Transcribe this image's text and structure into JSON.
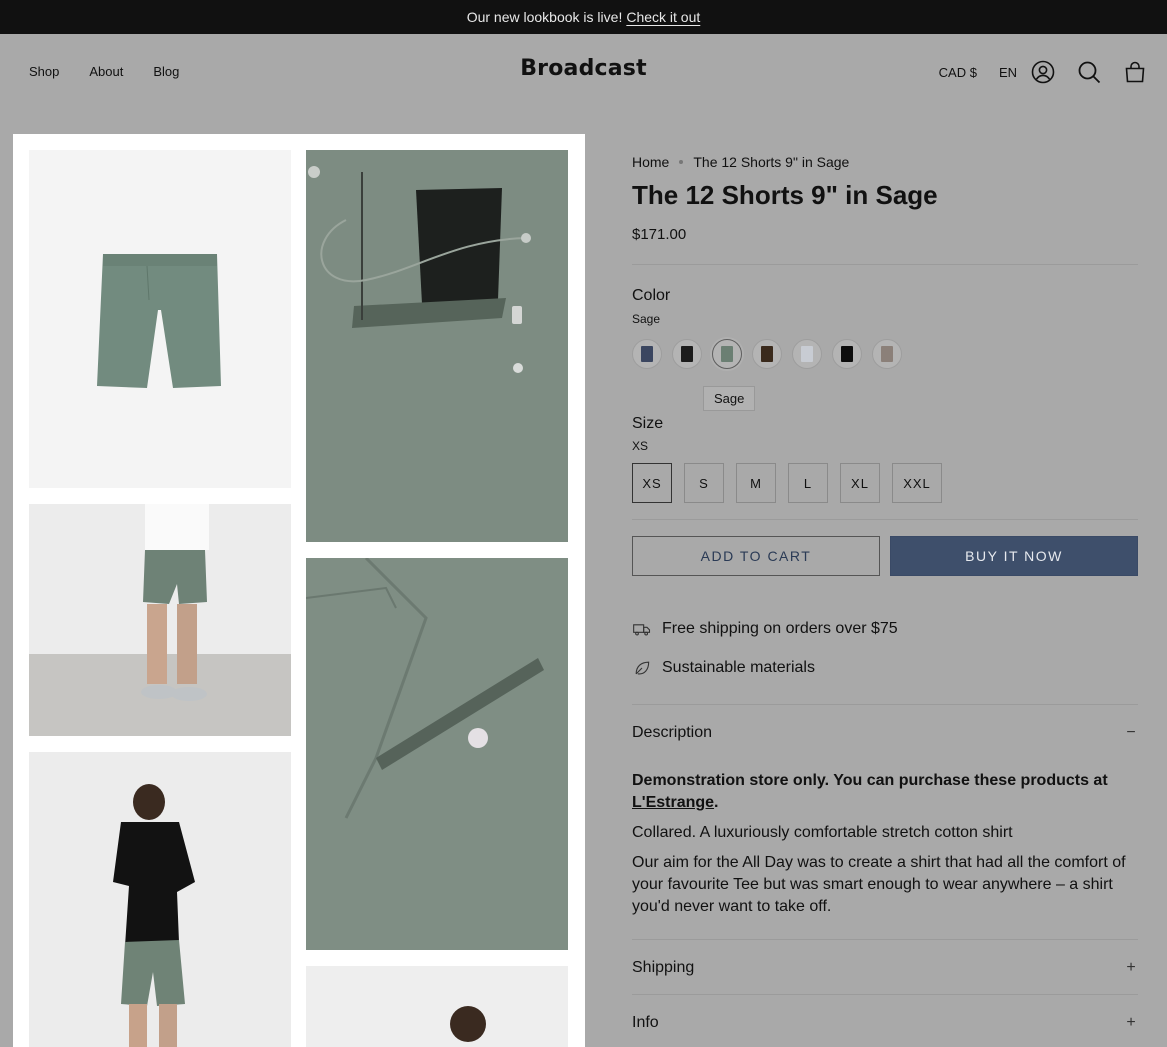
{
  "announcement": {
    "text": "Our new lookbook is live!",
    "link": "Check it out"
  },
  "header": {
    "nav": [
      "Shop",
      "About",
      "Blog"
    ],
    "logo": "Broadcast",
    "currency": "CAD $",
    "language": "EN",
    "icons": [
      "account-icon",
      "search-icon",
      "cart-icon"
    ]
  },
  "breadcrumb": {
    "home": "Home",
    "current": "The 12 Shorts 9\" in Sage"
  },
  "product": {
    "title": "The 12 Shorts 9\" in Sage",
    "price": "$171.00"
  },
  "color": {
    "label": "Color",
    "selected": "Sage",
    "tooltip": "Sage",
    "swatches": [
      "#3b4660",
      "#1c1c1c",
      "#6b7f73",
      "#3a2a1c",
      "#c8ccd3",
      "#0d0d0d",
      "#8b8079"
    ]
  },
  "size": {
    "label": "Size",
    "selected": "XS",
    "options": [
      "XS",
      "S",
      "M",
      "L",
      "XL",
      "XXL"
    ]
  },
  "buttons": {
    "add_to_cart": "ADD TO CART",
    "buy_now": "BUY IT NOW"
  },
  "features": [
    {
      "icon": "truck-icon",
      "text": "Free shipping on orders over $75"
    },
    {
      "icon": "leaf-icon",
      "text": "Sustainable materials"
    }
  ],
  "accordion": {
    "description": {
      "label": "Description",
      "symbol": "−"
    },
    "shipping": {
      "label": "Shipping",
      "symbol": "+"
    },
    "info": {
      "label": "Info",
      "symbol": "+"
    }
  },
  "description": {
    "bold_line": "Demonstration store only. You can purchase these products at",
    "bold_link": "L'Estrange",
    "bold_end": ".",
    "line2": "Collared. A luxuriously comfortable stretch cotton shirt",
    "line3": "Our aim for the All Day was to create a shirt that had all the comfort of your favourite Tee but was smart enough to wear anywhere – a shirt you'd never want to take off."
  }
}
